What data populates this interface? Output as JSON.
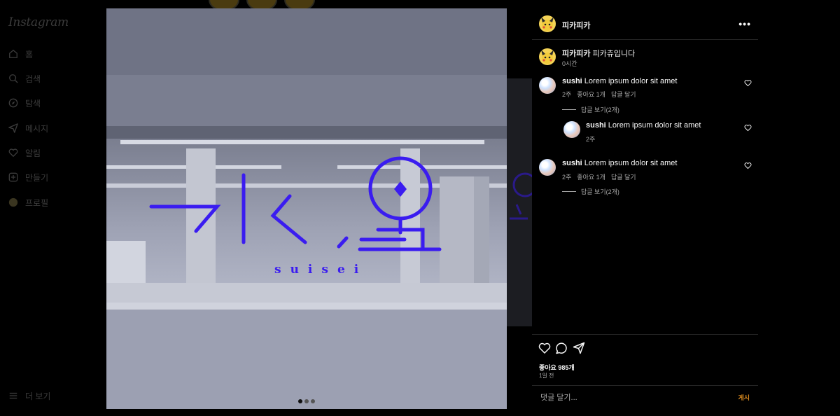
{
  "app": {
    "logo_text": "Instagram"
  },
  "nav": {
    "items": [
      {
        "label": "홈",
        "icon": "home-icon"
      },
      {
        "label": "검색",
        "icon": "search-icon"
      },
      {
        "label": "탐색",
        "icon": "compass-icon"
      },
      {
        "label": "메시지",
        "icon": "send-icon"
      },
      {
        "label": "알림",
        "icon": "heart-icon"
      },
      {
        "label": "만들기",
        "icon": "plus-square-icon"
      },
      {
        "label": "프로필",
        "icon": "avatar-icon"
      }
    ],
    "more_label": "더 보기"
  },
  "post": {
    "author": "피카피카",
    "caption": "피카츄입니다",
    "caption_time": "0시간",
    "image_text_latin": "suisei",
    "carousel": {
      "count": 3,
      "active_index": 0
    },
    "likes_label": "좋아요 985개",
    "date_label": "1일 전"
  },
  "comments": [
    {
      "user": "sushi",
      "text": "Lorem ipsum dolor sit amet",
      "time": "2주",
      "likes": "좋아요 1개",
      "reply": "답글 달기",
      "view_replies": "답글 보기(2개)",
      "replies": [
        {
          "user": "sushi",
          "text": "Lorem ipsum dolor sit amet",
          "time": "2주"
        }
      ]
    },
    {
      "user": "sushi",
      "text": "Lorem ipsum dolor sit amet",
      "time": "2주",
      "likes": "좋아요 1개",
      "reply": "답글 달기",
      "view_replies": "답글 보기(2개)",
      "replies": []
    }
  ],
  "comment_input": {
    "placeholder": "댓글 달기...",
    "post_label": "게시"
  },
  "colors": {
    "accent_purple": "#3a1cf0",
    "post_button": "#d98a1f",
    "avatar_yellow": "#f4d356"
  }
}
